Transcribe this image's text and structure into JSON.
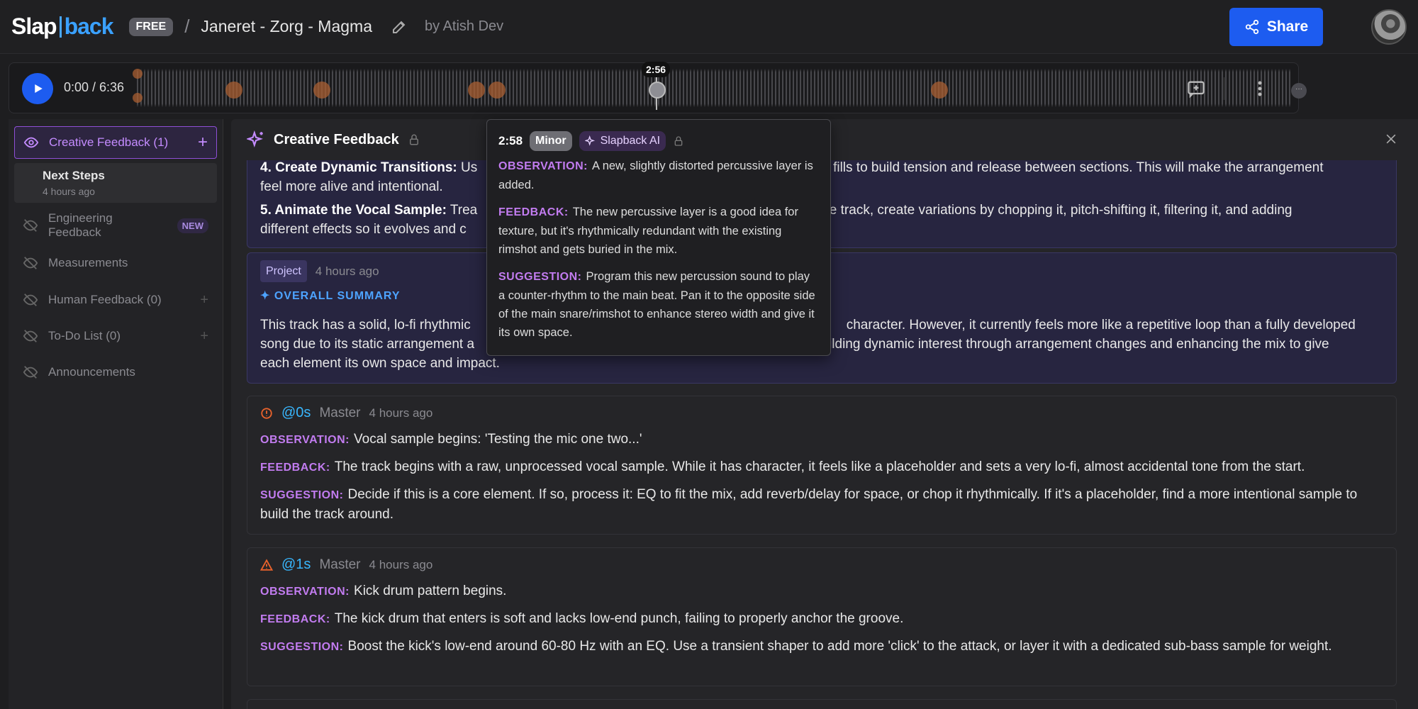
{
  "header": {
    "logo_left": "Slap",
    "logo_right": "back",
    "plan_badge": "FREE",
    "separator": "/",
    "track_title": "Janeret - Zorg - Magma",
    "author": "by Atish Dev",
    "share_label": "Share"
  },
  "player": {
    "time": "0:00 / 6:36",
    "playhead_label": "2:56",
    "end_marker": "···"
  },
  "sidebar": {
    "active": {
      "label": "Creative Feedback (1)",
      "plus": "+"
    },
    "sub": {
      "title": "Next Steps",
      "date": "4 hours ago"
    },
    "items": [
      {
        "label": "Engineering Feedback",
        "badge": "NEW"
      },
      {
        "label": "Measurements"
      },
      {
        "label": "Human Feedback (0)",
        "plus": "+"
      },
      {
        "label": "To-Do List (0)",
        "plus": "+"
      },
      {
        "label": "Announcements"
      }
    ]
  },
  "main": {
    "title": "Creative Feedback",
    "next_steps": {
      "item4_title": "4. Create Dynamic Transitions:",
      "item4_text_a": " Us",
      "item4_text_b": "n fills to build tension and release between sections. This will make the arrangement",
      "item4_text_c": "feel more alive and intentional.",
      "item5_title": "5. Animate the Vocal Sample:",
      "item5_text_a": " Trea",
      "item5_text_b": "he track, create variations by chopping it, pitch-shifting it, filtering it, and adding",
      "item5_text_c": "different effects so it evolves and c"
    },
    "summary": {
      "badge": "Project",
      "time": "4 hours ago",
      "heading": "OVERALL SUMMARY",
      "line1_a": "This track has a solid, lo-fi rhythmic",
      "line1_b": "character. However, it currently feels more like a repetitive loop than a fully developed",
      "line2_a": "song due to its static arrangement a",
      "line2_b": "ilding dynamic interest through arrangement changes and enhancing the mix to give",
      "line3": "each element its own space and impact."
    },
    "comments": [
      {
        "timestamp": "@0s",
        "track": "Master",
        "time": "4 hours ago",
        "observation": "Vocal sample begins: 'Testing the mic one two...'",
        "feedback": "The track begins with a raw, unprocessed vocal sample. While it has character, it feels like a placeholder and sets a very lo-fi, almost accidental tone from the start.",
        "suggestion": "Decide if this is a core element. If so, process it: EQ to fit the mix, add reverb/delay for space, or chop it rhythmically. If it's a placeholder, find a more intentional sample to build the track around."
      },
      {
        "timestamp": "@1s",
        "track": "Master",
        "time": "4 hours ago",
        "observation": "Kick drum pattern begins.",
        "feedback": "The kick drum that enters is soft and lacks low-end punch, failing to properly anchor the groove.",
        "suggestion": "Boost the kick's low-end around 60-80 Hz with an EQ. Use a transient shaper to add more 'click' to the attack, or layer it with a dedicated sub-bass sample for weight."
      }
    ],
    "labels": {
      "observation": "OBSERVATION:",
      "feedback": "FEEDBACK:",
      "suggestion": "SUGGESTION:"
    }
  },
  "tooltip": {
    "time": "2:58",
    "severity": "Minor",
    "source": "Slapback AI",
    "observation": "A new, slightly distorted percussive layer is added.",
    "feedback": "The new percussive layer is a good idea for texture, but it's rhythmically redundant with the existing rimshot and gets buried in the mix.",
    "suggestion": "Program this new percussion sound to play a counter-rhythm to the main beat. Pan it to the opposite side of the main snare/rimshot to enhance stereo width and give it its own space."
  },
  "colors": {
    "accent_blue": "#1d5cf0",
    "label_purple": "#c27cf0",
    "timestamp_cyan": "#38b7ff",
    "marker_orange": "#aa5f32"
  }
}
